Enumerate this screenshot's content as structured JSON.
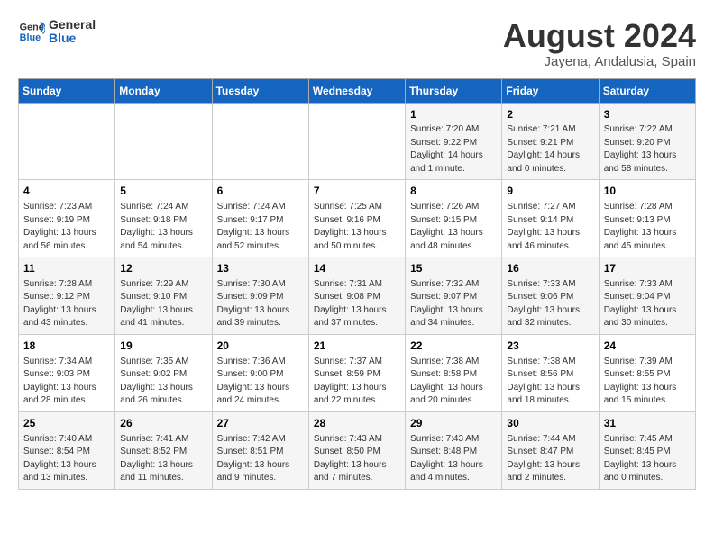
{
  "logo": {
    "line1": "General",
    "line2": "Blue"
  },
  "title": "August 2024",
  "subtitle": "Jayena, Andalusia, Spain",
  "days_of_week": [
    "Sunday",
    "Monday",
    "Tuesday",
    "Wednesday",
    "Thursday",
    "Friday",
    "Saturday"
  ],
  "weeks": [
    [
      {
        "day": "",
        "info": ""
      },
      {
        "day": "",
        "info": ""
      },
      {
        "day": "",
        "info": ""
      },
      {
        "day": "",
        "info": ""
      },
      {
        "day": "1",
        "info": "Sunrise: 7:20 AM\nSunset: 9:22 PM\nDaylight: 14 hours\nand 1 minute."
      },
      {
        "day": "2",
        "info": "Sunrise: 7:21 AM\nSunset: 9:21 PM\nDaylight: 14 hours\nand 0 minutes."
      },
      {
        "day": "3",
        "info": "Sunrise: 7:22 AM\nSunset: 9:20 PM\nDaylight: 13 hours\nand 58 minutes."
      }
    ],
    [
      {
        "day": "4",
        "info": "Sunrise: 7:23 AM\nSunset: 9:19 PM\nDaylight: 13 hours\nand 56 minutes."
      },
      {
        "day": "5",
        "info": "Sunrise: 7:24 AM\nSunset: 9:18 PM\nDaylight: 13 hours\nand 54 minutes."
      },
      {
        "day": "6",
        "info": "Sunrise: 7:24 AM\nSunset: 9:17 PM\nDaylight: 13 hours\nand 52 minutes."
      },
      {
        "day": "7",
        "info": "Sunrise: 7:25 AM\nSunset: 9:16 PM\nDaylight: 13 hours\nand 50 minutes."
      },
      {
        "day": "8",
        "info": "Sunrise: 7:26 AM\nSunset: 9:15 PM\nDaylight: 13 hours\nand 48 minutes."
      },
      {
        "day": "9",
        "info": "Sunrise: 7:27 AM\nSunset: 9:14 PM\nDaylight: 13 hours\nand 46 minutes."
      },
      {
        "day": "10",
        "info": "Sunrise: 7:28 AM\nSunset: 9:13 PM\nDaylight: 13 hours\nand 45 minutes."
      }
    ],
    [
      {
        "day": "11",
        "info": "Sunrise: 7:28 AM\nSunset: 9:12 PM\nDaylight: 13 hours\nand 43 minutes."
      },
      {
        "day": "12",
        "info": "Sunrise: 7:29 AM\nSunset: 9:10 PM\nDaylight: 13 hours\nand 41 minutes."
      },
      {
        "day": "13",
        "info": "Sunrise: 7:30 AM\nSunset: 9:09 PM\nDaylight: 13 hours\nand 39 minutes."
      },
      {
        "day": "14",
        "info": "Sunrise: 7:31 AM\nSunset: 9:08 PM\nDaylight: 13 hours\nand 37 minutes."
      },
      {
        "day": "15",
        "info": "Sunrise: 7:32 AM\nSunset: 9:07 PM\nDaylight: 13 hours\nand 34 minutes."
      },
      {
        "day": "16",
        "info": "Sunrise: 7:33 AM\nSunset: 9:06 PM\nDaylight: 13 hours\nand 32 minutes."
      },
      {
        "day": "17",
        "info": "Sunrise: 7:33 AM\nSunset: 9:04 PM\nDaylight: 13 hours\nand 30 minutes."
      }
    ],
    [
      {
        "day": "18",
        "info": "Sunrise: 7:34 AM\nSunset: 9:03 PM\nDaylight: 13 hours\nand 28 minutes."
      },
      {
        "day": "19",
        "info": "Sunrise: 7:35 AM\nSunset: 9:02 PM\nDaylight: 13 hours\nand 26 minutes."
      },
      {
        "day": "20",
        "info": "Sunrise: 7:36 AM\nSunset: 9:00 PM\nDaylight: 13 hours\nand 24 minutes."
      },
      {
        "day": "21",
        "info": "Sunrise: 7:37 AM\nSunset: 8:59 PM\nDaylight: 13 hours\nand 22 minutes."
      },
      {
        "day": "22",
        "info": "Sunrise: 7:38 AM\nSunset: 8:58 PM\nDaylight: 13 hours\nand 20 minutes."
      },
      {
        "day": "23",
        "info": "Sunrise: 7:38 AM\nSunset: 8:56 PM\nDaylight: 13 hours\nand 18 minutes."
      },
      {
        "day": "24",
        "info": "Sunrise: 7:39 AM\nSunset: 8:55 PM\nDaylight: 13 hours\nand 15 minutes."
      }
    ],
    [
      {
        "day": "25",
        "info": "Sunrise: 7:40 AM\nSunset: 8:54 PM\nDaylight: 13 hours\nand 13 minutes."
      },
      {
        "day": "26",
        "info": "Sunrise: 7:41 AM\nSunset: 8:52 PM\nDaylight: 13 hours\nand 11 minutes."
      },
      {
        "day": "27",
        "info": "Sunrise: 7:42 AM\nSunset: 8:51 PM\nDaylight: 13 hours\nand 9 minutes."
      },
      {
        "day": "28",
        "info": "Sunrise: 7:43 AM\nSunset: 8:50 PM\nDaylight: 13 hours\nand 7 minutes."
      },
      {
        "day": "29",
        "info": "Sunrise: 7:43 AM\nSunset: 8:48 PM\nDaylight: 13 hours\nand 4 minutes."
      },
      {
        "day": "30",
        "info": "Sunrise: 7:44 AM\nSunset: 8:47 PM\nDaylight: 13 hours\nand 2 minutes."
      },
      {
        "day": "31",
        "info": "Sunrise: 7:45 AM\nSunset: 8:45 PM\nDaylight: 13 hours\nand 0 minutes."
      }
    ]
  ]
}
